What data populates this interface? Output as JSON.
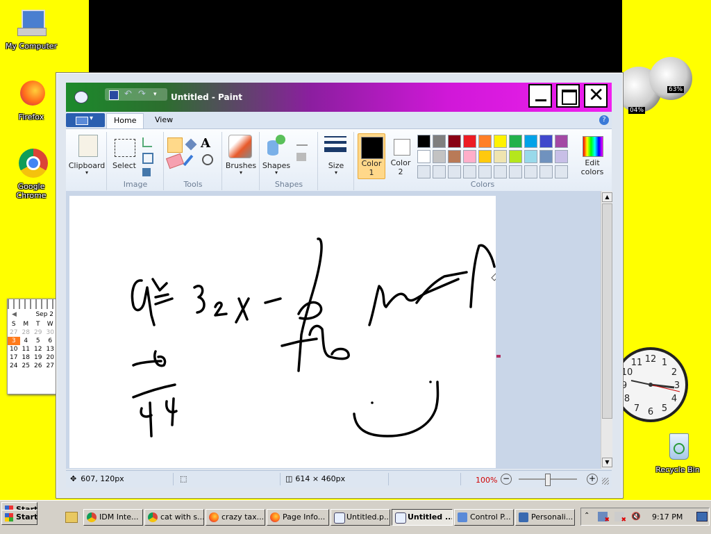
{
  "desktop": {
    "icons": [
      {
        "label": "My Computer"
      },
      {
        "label": "Firefox"
      },
      {
        "label": "Google Chrome"
      },
      {
        "label": "Recycle Bin"
      }
    ],
    "gadgets": {
      "cpu_meter": {
        "left_value": "04%",
        "right_value": "63%"
      },
      "calendar": {
        "month": "Sep 2",
        "weekdays": [
          "S",
          "M",
          "T",
          "W"
        ],
        "rows": [
          [
            "27",
            "28",
            "29",
            "30"
          ],
          [
            "3",
            "4",
            "5",
            "6"
          ],
          [
            "10",
            "11",
            "12",
            "13"
          ],
          [
            "17",
            "18",
            "19",
            "20"
          ],
          [
            "24",
            "25",
            "26",
            "27"
          ]
        ]
      },
      "clock": {
        "numbers": [
          "12",
          "1",
          "2",
          "3",
          "4",
          "5",
          "6",
          "7",
          "8",
          "9",
          "10",
          "11"
        ]
      }
    }
  },
  "window": {
    "title": "Untitled - Paint",
    "tabs": [
      {
        "label": "Home"
      },
      {
        "label": "View"
      }
    ],
    "ribbon": {
      "clipboard": {
        "button": "Clipboard"
      },
      "image": {
        "select": "Select",
        "group": "Image"
      },
      "tools": {
        "group": "Tools",
        "text_tool": "A"
      },
      "brushes": {
        "button": "Brushes"
      },
      "shapes": {
        "button": "Shapes",
        "group": "Shapes"
      },
      "size": {
        "button": "Size"
      },
      "colors": {
        "color1": "Color 1",
        "color1_l1": "Color",
        "color1_l2": "1",
        "color2_l1": "Color",
        "color2_l2": "2",
        "edit_l1": "Edit",
        "edit_l2": "colors",
        "group": "Colors",
        "palette_row1": [
          "#000000",
          "#7f7f7f",
          "#880015",
          "#ed1c24",
          "#ff7f27",
          "#fff200",
          "#22b14c",
          "#00a2e8",
          "#3f48cc",
          "#a349a4"
        ],
        "palette_row2": [
          "#ffffff",
          "#c3c3c3",
          "#b97a57",
          "#ffaec9",
          "#ffc90e",
          "#efe4b0",
          "#b5e61d",
          "#99d9ea",
          "#7092be",
          "#c8bfe7"
        ]
      }
    },
    "status": {
      "cursor": "607, 120px",
      "image_size": "614 × 460px",
      "zoom": "100%"
    }
  },
  "taskbar": {
    "start": "Start",
    "items": [
      {
        "label": "IDM Inte..."
      },
      {
        "label": "cat with s..."
      },
      {
        "label": "crazy tax..."
      },
      {
        "label": "Page Info..."
      },
      {
        "label": "Untitled.p..."
      },
      {
        "label": "Untitled ..."
      },
      {
        "label": "Control P..."
      },
      {
        "label": "Personali..."
      }
    ],
    "clock": "9:17 PM"
  },
  "colors": {
    "desktop_bg": "#ffff00",
    "zoom_text": "#d00000",
    "title_gradient_start": "#1c8a2c",
    "title_gradient_end": "#f020f0"
  }
}
